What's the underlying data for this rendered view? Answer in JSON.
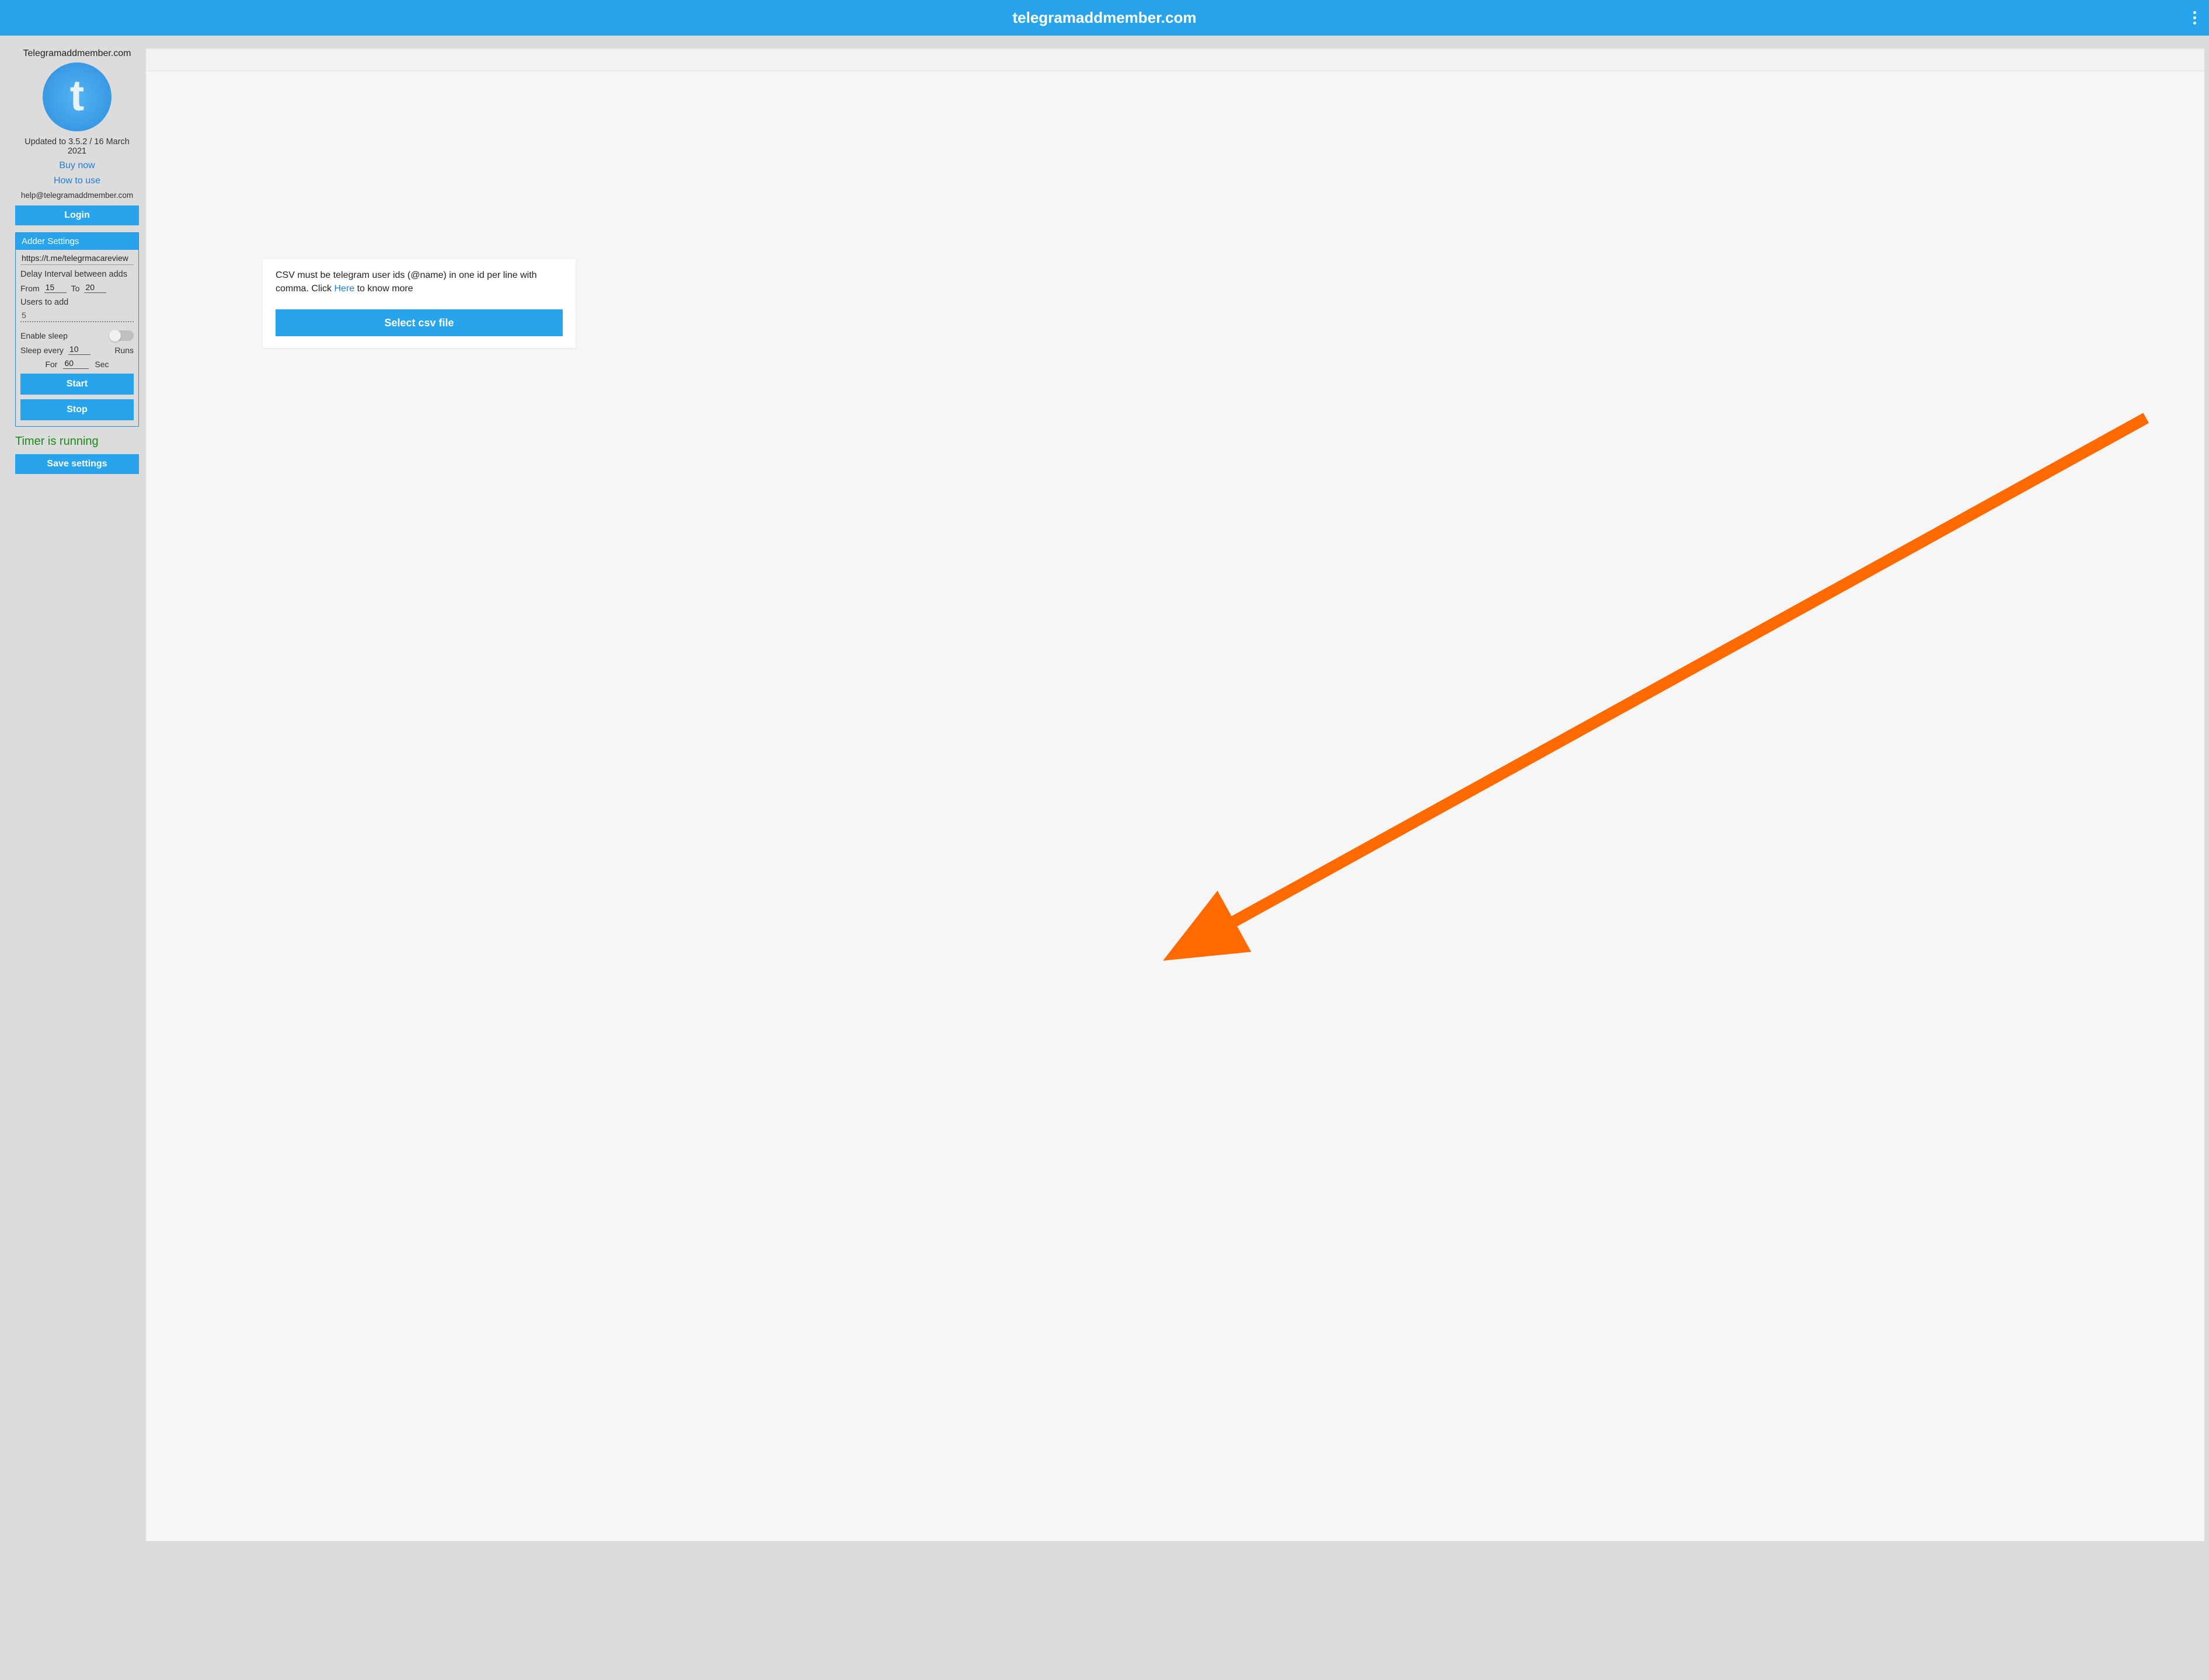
{
  "header": {
    "title": "telegramaddmember.com"
  },
  "sidebar": {
    "brand_name": "Telegramaddmember.com",
    "logo_letter": "t",
    "version_line": "Updated to 3.5.2 / 16 March 2021",
    "buy_now": "Buy now",
    "how_to_use": "How to use",
    "help_email": "help@telegramaddmember.com",
    "login_label": "Login",
    "panel_title": "Adder Settings",
    "url_value": "https://t.me/telegrmacareview",
    "delay_label": "Delay Interval between adds",
    "from_label": "From",
    "from_value": "15",
    "to_label": "To",
    "to_value": "20",
    "users_label": "Users to add",
    "users_value": "5",
    "enable_sleep_label": "Enable sleep",
    "enable_sleep_on": false,
    "sleep_every_label": "Sleep every",
    "sleep_every_value": "10",
    "runs_label": "Runs",
    "for_label": "For",
    "for_value": "60",
    "sec_label": "Sec",
    "start_label": "Start",
    "stop_label": "Stop",
    "timer_status": "Timer is running",
    "save_label": "Save settings"
  },
  "main": {
    "csv_info_line1": "CSV must be telegram user ids (@name) in one id per line with comma.",
    "csv_info_click": "Click ",
    "csv_info_here": "Here",
    "csv_info_rest": " to know more",
    "select_csv_label": "Select csv file"
  },
  "colors": {
    "accent": "#27a4ec",
    "arrow": "#ff6a00",
    "timer_green": "#1a8a1b"
  }
}
